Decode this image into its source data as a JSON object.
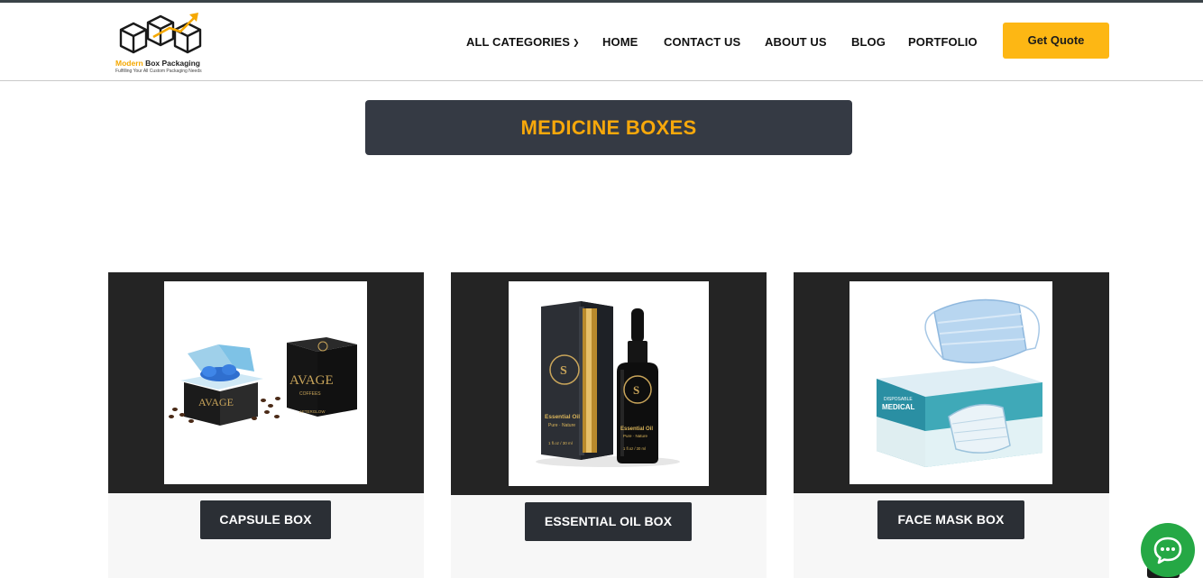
{
  "header": {
    "logo": {
      "name_accent": "Modern",
      "name_rest": " Box Packaging",
      "tagline": "Fulfilling Your All Custom Packaging Needs",
      "icon": "cube-boxes-arrow-logo"
    },
    "nav": [
      {
        "label": "ALL CATEGORIES",
        "has_dropdown": true
      },
      {
        "label": "HOME"
      },
      {
        "label": "CONTACT US"
      },
      {
        "label": "ABOUT US"
      },
      {
        "label": "BLOG"
      },
      {
        "label": "PORTFOLIO"
      }
    ],
    "quote_button": "Get Quote"
  },
  "page": {
    "title": "MEDICINE BOXES"
  },
  "products": [
    {
      "label": "CAPSULE BOX",
      "image": "capsule-box-image"
    },
    {
      "label": "ESSENTIAL OIL BOX",
      "image": "essential-oil-box-image"
    },
    {
      "label": "FACE MASK BOX",
      "image": "face-mask-box-image"
    }
  ],
  "product_images": {
    "capsule": {
      "brand": "AVAGE",
      "sub": "COFFEES",
      "bottom": "AFTERGLOW"
    },
    "oil": {
      "brand_letter": "S",
      "line1": "Essential Oil",
      "line2": "Pure · Nature",
      "line3": "1 fl.oz / 30 ml"
    },
    "mask": {
      "line1": "DISPOSABLE",
      "line2": "MEDICAL"
    }
  },
  "chat": {
    "icon": "chat-bubble-icon"
  },
  "colors": {
    "accent": "#fdb714",
    "title_text": "#f7a80b",
    "banner_bg": "#353a44",
    "card_dark": "#242424",
    "chat_green": "#25a845"
  }
}
